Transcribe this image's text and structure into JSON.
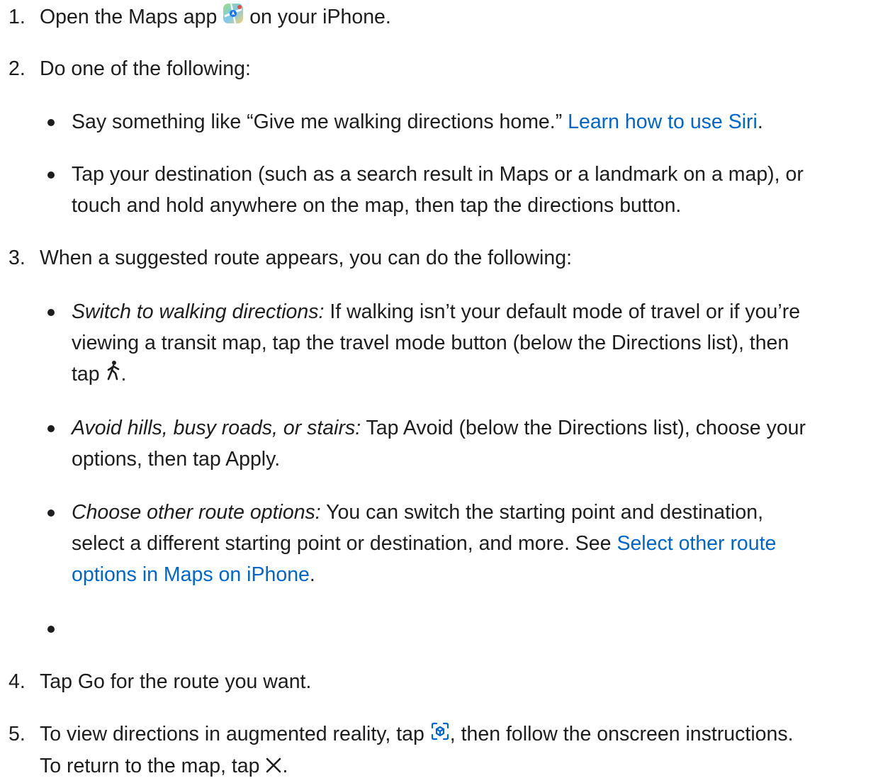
{
  "steps": [
    {
      "num": "1.",
      "pre": "Open the Maps app",
      "post": " on your iPhone.",
      "icon": "maps-app-icon"
    },
    {
      "num": "2.",
      "text": "Do one of the following:"
    },
    {
      "num": "3.",
      "text": "When a suggested route appears, you can do the following:"
    },
    {
      "num": "4.",
      "text": "Tap Go for the route you want."
    },
    {
      "num": "5.",
      "pre": "To view directions in augmented reality, tap",
      "post": ", then follow the onscreen instructions.",
      "line2_pre": "To return to the map, tap",
      "line2_post": ".",
      "icons": [
        "ar-icon",
        "close-icon"
      ]
    }
  ],
  "step2_bullets": {
    "b1": {
      "text": "Say something like “Give me walking directions home.” ",
      "link": "Learn how to use Siri",
      "after": "."
    },
    "b2": {
      "line1": "Tap your destination (such as a search result in Maps or a landmark on a map), or",
      "line2": "touch and hold anywhere on the map, then tap the directions button."
    }
  },
  "step3_bullets": {
    "b1": {
      "em": "Switch to walking directions:",
      "line1": " If walking isn’t your default mode of travel or if you’re",
      "line2": "viewing a transit map, tap the travel mode button (below the Directions list), then",
      "line3_pre": "tap",
      "line3_post": ".",
      "icon": "walking-icon"
    },
    "b2": {
      "em": "Avoid hills, busy roads, or stairs:",
      "line1": " Tap Avoid (below the Directions list), choose your",
      "line2": "options, then tap Apply."
    },
    "b3": {
      "em": "Choose other route options:",
      "line1": " You can switch the starting point and destination,",
      "line2_pre": "select a different starting point or destination, and more. See ",
      "link1": "Select other route",
      "link2": "options in Maps on iPhone",
      "after": "."
    }
  },
  "colors": {
    "text": "#1d1d1f",
    "link": "#0066cc"
  }
}
